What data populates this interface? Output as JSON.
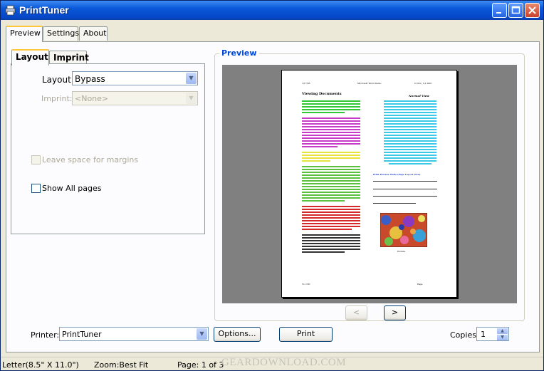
{
  "window": {
    "title": "PrintTuner"
  },
  "main_tabs": [
    {
      "label": "Preview",
      "active": true
    },
    {
      "label": "Settings",
      "active": false
    },
    {
      "label": "About",
      "active": false
    }
  ],
  "inner_tabs": [
    {
      "label": "Layout",
      "active": true
    },
    {
      "label": "Imprint",
      "active": false
    }
  ],
  "layout_panel": {
    "layout_label": "Layout:",
    "layout_value": "Bypass",
    "imprint_label": "Imprint:",
    "imprint_value": "<None>",
    "leave_space_label": "Leave space for margins",
    "leave_space_checked": false,
    "show_all_label": "Show All pages",
    "show_all_checked": false
  },
  "preview": {
    "group_title": "Preview",
    "prev_button": "<",
    "next_button": ">",
    "page_header": [
      "1/17/05",
      "Microsoft Word Demo",
      "C:\\Doc_1\\1.DOC"
    ],
    "left_heading": "Viewing Documents",
    "right_heading": "Normal View",
    "blue_heading": "Print Preview Mode (Page Layout View)",
    "picture_caption": "Picture",
    "footer_left": "To: Ctrl",
    "footer_right": "Page"
  },
  "bottom": {
    "printer_label": "Printer:",
    "printer_value": "PrintTuner",
    "options_button": "Options...",
    "print_button": "Print",
    "copies_label": "Copies:",
    "copies_value": "1"
  },
  "status": {
    "paper": "Letter(8.5\" X 11.0\")",
    "zoom": "Zoom:Best Fit",
    "page": "Page: 1 of 3"
  },
  "watermark": "GEARDOWNLOAD.COM"
}
